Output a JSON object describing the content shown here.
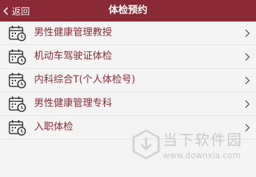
{
  "header": {
    "back_label": "返回",
    "title": "体检预约"
  },
  "items": [
    {
      "label": "男性健康管理教授"
    },
    {
      "label": "机动车驾驶证体检"
    },
    {
      "label": "内科综合T(个人体检号)"
    },
    {
      "label": "男性健康管理专科"
    },
    {
      "label": "入职体检"
    }
  ],
  "watermark": {
    "name": "当下软件园",
    "url": "www.downxia.com"
  },
  "colors": {
    "header_bg": "#8a2a35",
    "item_text": "#8a2a35",
    "background": "#f4f4f4"
  },
  "icons": {
    "back": "chevron-left-icon",
    "item": "calendar-clock-icon",
    "row_arrow": "chevron-right-icon"
  }
}
